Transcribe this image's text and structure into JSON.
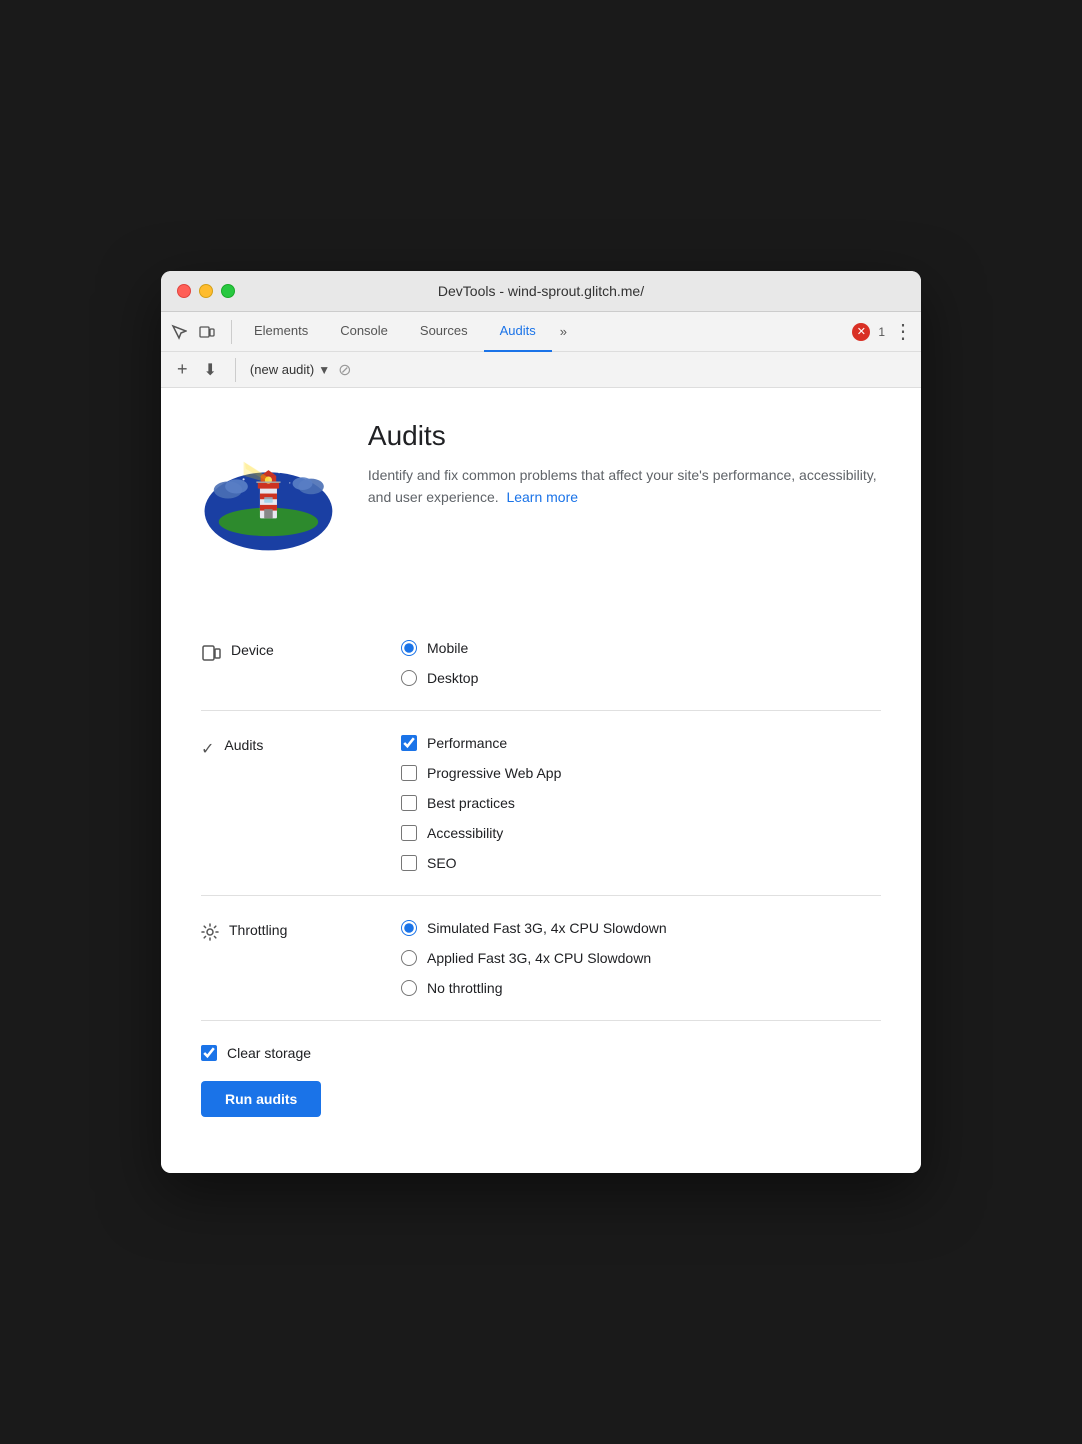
{
  "window": {
    "title": "DevTools - wind-sprout.glitch.me/"
  },
  "tabs": [
    {
      "label": "Elements",
      "active": false
    },
    {
      "label": "Console",
      "active": false
    },
    {
      "label": "Sources",
      "active": false
    },
    {
      "label": "Audits",
      "active": true
    }
  ],
  "tab_more_label": "»",
  "error_count": "1",
  "sub_toolbar": {
    "new_label": "+",
    "download_label": "⬇",
    "audit_name": "(new audit)",
    "stop_label": "⊘"
  },
  "hero": {
    "title": "Audits",
    "description": "Identify and fix common problems that affect your site's performance, accessibility, and user experience.",
    "learn_more": "Learn more"
  },
  "device_section": {
    "label": "Device",
    "options": [
      {
        "label": "Mobile",
        "checked": true
      },
      {
        "label": "Desktop",
        "checked": false
      }
    ]
  },
  "audits_section": {
    "label": "Audits",
    "options": [
      {
        "label": "Performance",
        "checked": true
      },
      {
        "label": "Progressive Web App",
        "checked": false
      },
      {
        "label": "Best practices",
        "checked": false
      },
      {
        "label": "Accessibility",
        "checked": false
      },
      {
        "label": "SEO",
        "checked": false
      }
    ]
  },
  "throttling_section": {
    "label": "Throttling",
    "options": [
      {
        "label": "Simulated Fast 3G, 4x CPU Slowdown",
        "checked": true
      },
      {
        "label": "Applied Fast 3G, 4x CPU Slowdown",
        "checked": false
      },
      {
        "label": "No throttling",
        "checked": false
      }
    ]
  },
  "bottom": {
    "clear_storage_label": "Clear storage",
    "clear_storage_checked": true,
    "run_button_label": "Run audits"
  }
}
